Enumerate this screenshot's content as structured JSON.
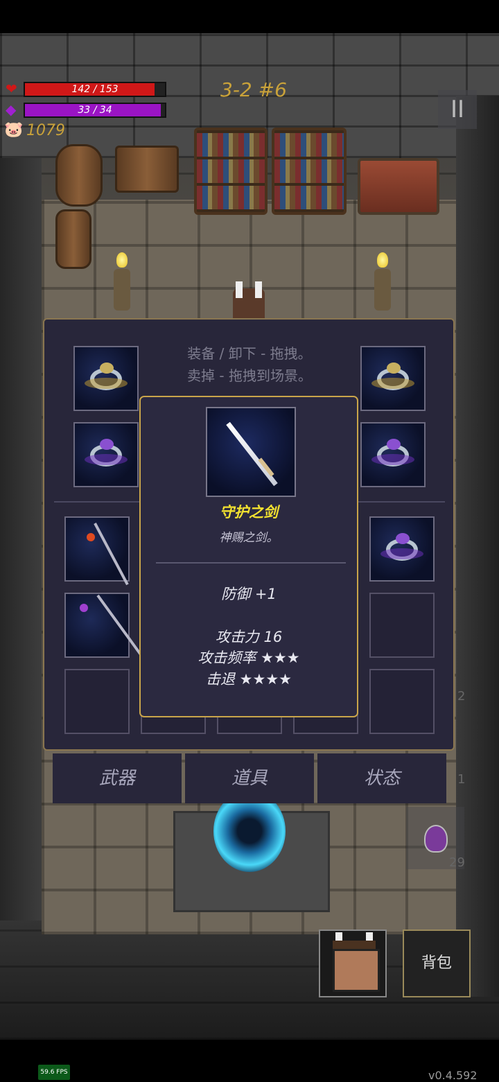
{
  "hud": {
    "hp_text": "142 / 153",
    "hp_value": 142,
    "hp_max": 153,
    "mp_text": "33 / 34",
    "mp_value": 33,
    "mp_max": 34,
    "gold": "1079",
    "stage": "3-2 #6",
    "pause_label": "II",
    "hp_icon": "heart-icon",
    "mp_icon": "diamond-icon",
    "gold_icon": "pig-icon",
    "hp_color": "#d01818",
    "mp_color": "#9a14c4",
    "accent_gold": "#c9a23a"
  },
  "inventory": {
    "hint_line1": "装备 / 卸下 - 拖拽。",
    "hint_line2": "卖掉 - 拖拽到场景。",
    "tabs": [
      "武器",
      "道具",
      "状态"
    ]
  },
  "tooltip": {
    "name": "守护之剑",
    "description": "神赐之剑。",
    "defense": "防御 +1",
    "attack": "攻击力 16",
    "attack_rate": "攻击频率 ★★★",
    "knockback": "击退 ★★★★",
    "name_color": "#f3e230",
    "border_color": "#c9a54a"
  },
  "bottom": {
    "bag_label": "背包",
    "potion_count": "29",
    "side_count_1": "2",
    "side_count_2": "1"
  },
  "debug": {
    "fps": "59.6 FPS",
    "version": "v0.4.592"
  }
}
